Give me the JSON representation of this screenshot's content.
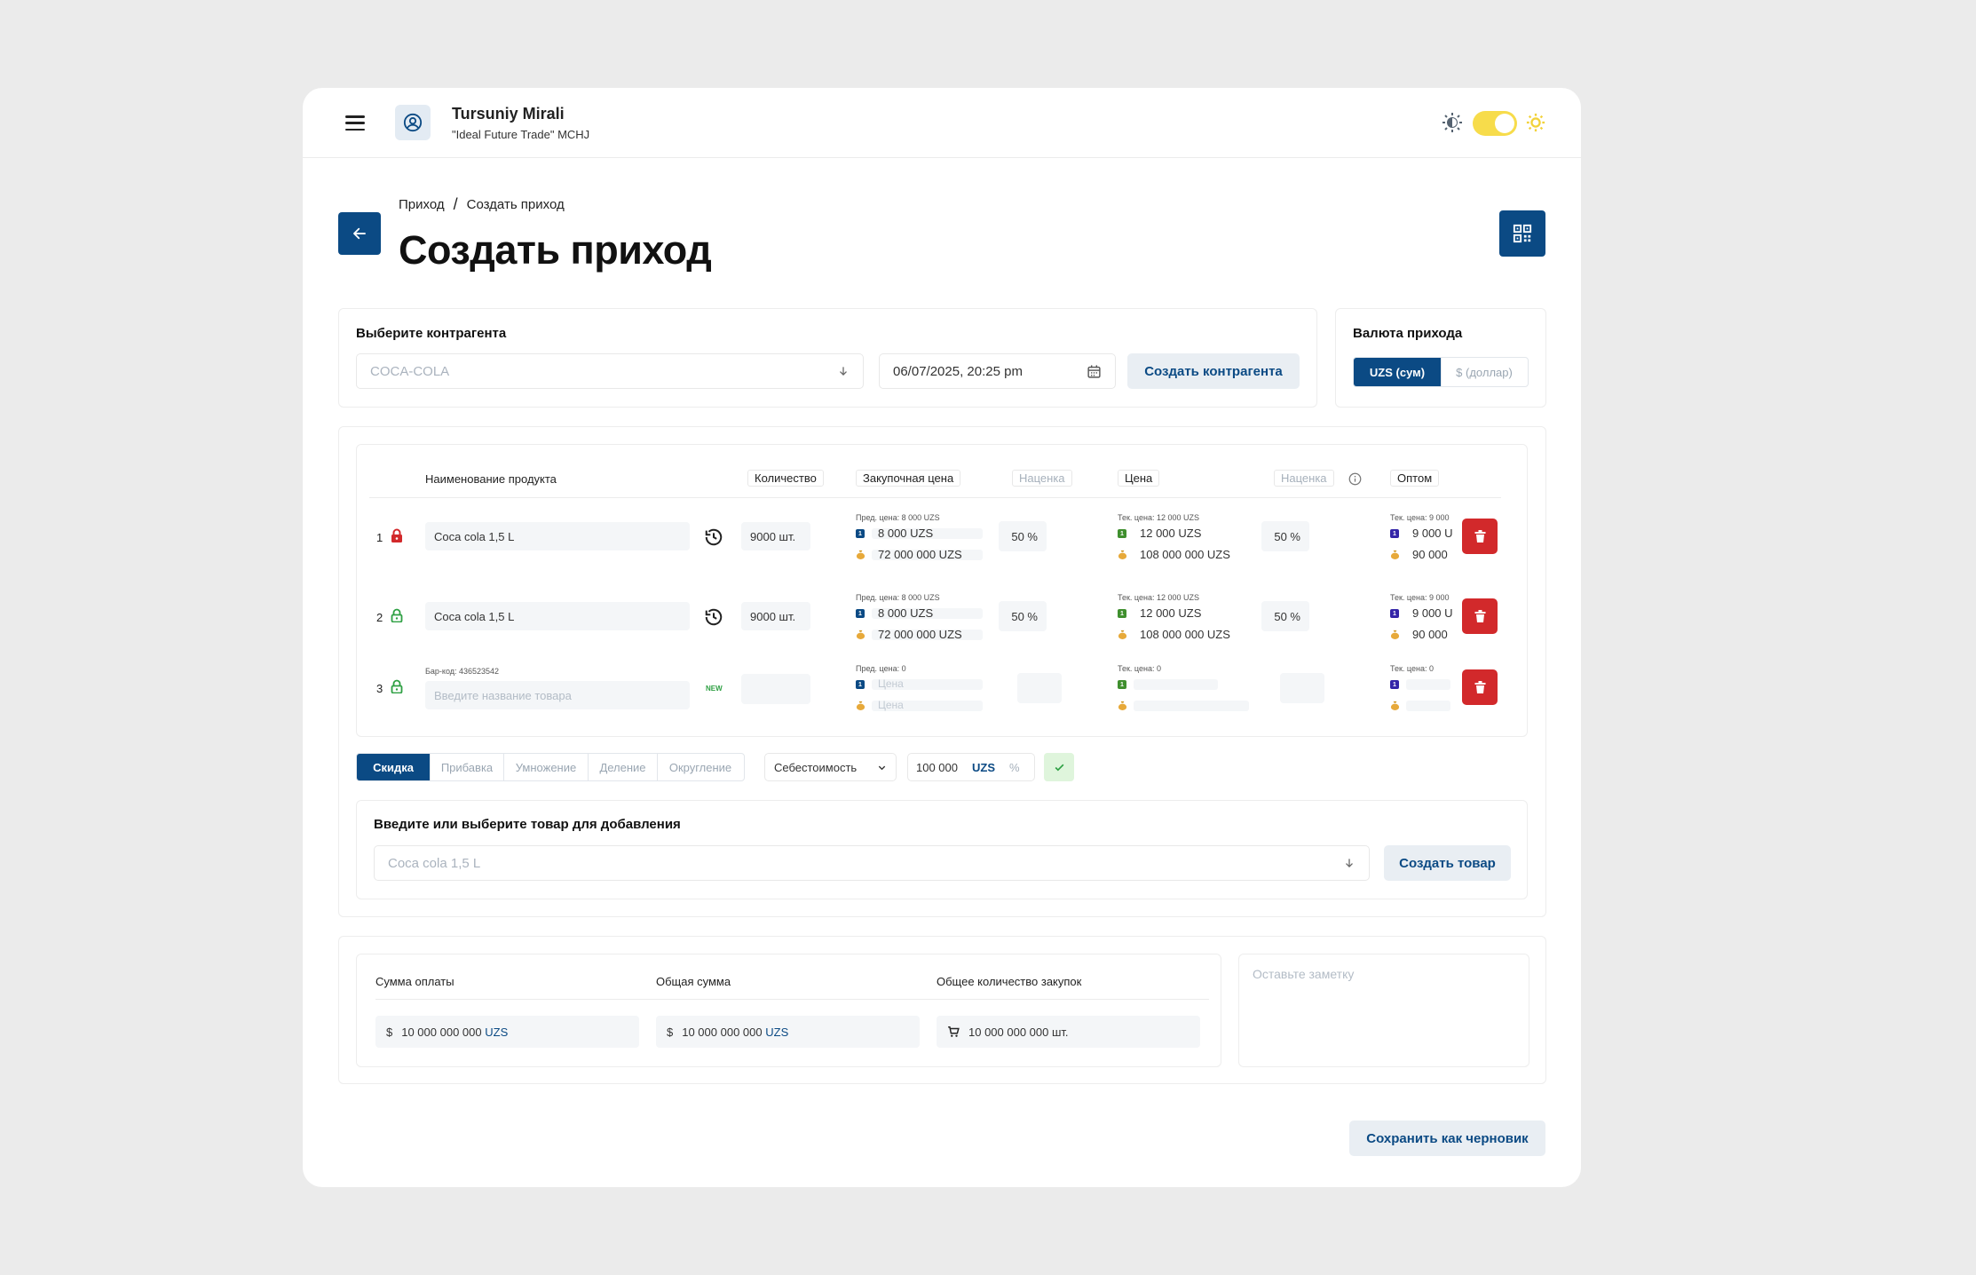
{
  "header": {
    "user_name": "Tursuniy Mirali",
    "user_org": "\"Ideal Future Trade\" MCHJ"
  },
  "breadcrumb": {
    "parent": "Приход",
    "sep": "/",
    "current": "Создать приход"
  },
  "page_title": "Создать приход",
  "counterparty": {
    "label": "Выберите контрагента",
    "placeholder": "COCA-COLA",
    "date": "06/07/2025, 20:25 pm",
    "create_button": "Создать контрагента"
  },
  "currency": {
    "label": "Валюта прихода",
    "options": [
      "UZS (сум)",
      "$ (доллар)"
    ],
    "selected": "UZS (сум)"
  },
  "table": {
    "headers": {
      "product": "Наименование продукта",
      "quantity": "Количество",
      "purchase_price": "Закупочная цена",
      "markup1": "Наценка",
      "price": "Цена",
      "markup2": "Наценка",
      "wholesale": "Оптом"
    },
    "rows": [
      {
        "num": "1",
        "locked": true,
        "product": "Coca cola 1,5 L",
        "quantity": "9000 шт.",
        "prev_price": "Пред. цена: 8 000 UZS",
        "purchase": "8 000 UZS",
        "purchase_total": "72 000 000 UZS",
        "markup1": "50 %",
        "cur_price": "Тек. цена: 12 000 UZS",
        "price": "12 000 UZS",
        "price_total": "108 000 000 UZS",
        "markup2": "50 %",
        "ws_cur": "Тек. цена: 9 000",
        "ws": "9 000 U",
        "ws_total": "90 000"
      },
      {
        "num": "2",
        "locked": false,
        "product": "Coca cola 1,5 L",
        "quantity": "9000 шт.",
        "prev_price": "Пред. цена: 8 000 UZS",
        "purchase": "8 000 UZS",
        "purchase_total": "72 000 000 UZS",
        "markup1": "50 %",
        "cur_price": "Тек. цена: 12 000 UZS",
        "price": "12 000 UZS",
        "price_total": "108 000 000 UZS",
        "markup2": "50 %",
        "ws_cur": "Тек. цена: 9 000",
        "ws": "9 000 U",
        "ws_total": "90 000"
      },
      {
        "num": "3",
        "locked": false,
        "barcode": "Бар-код: 436523542",
        "placeholder": "Введите название товара",
        "badge": "NEW",
        "prev_price": "Пред. цена: 0",
        "price_ph": "Цена",
        "price_ph2": "Цена",
        "cur_price": "Тек. цена: 0",
        "ws_cur": "Тек. цена: 0"
      }
    ]
  },
  "operations": {
    "tabs": [
      "Скидка",
      "Прибавка",
      "Умножение",
      "Деление",
      "Округление"
    ],
    "active": "Скидка",
    "base": "Себестоимость",
    "amount": "100 000",
    "unit_uzs": "UZS",
    "unit_pct": "%"
  },
  "add_product": {
    "label": "Введите или выберите товар для добавления",
    "placeholder": "Coca cola 1,5 L",
    "create_button": "Создать товар"
  },
  "summary": {
    "payment_label": "Сумма оплаты",
    "total_label": "Общая сумма",
    "count_label": "Общее количество закупок",
    "payment_value": "10 000 000 000",
    "total_value": "10 000 000 000",
    "count_value": "10 000 000 000 шт.",
    "currency": "UZS",
    "dollar_sign": "$"
  },
  "note_placeholder": "Оставьте заметку",
  "save_draft": "Сохранить как черновик",
  "colors": {
    "primary": "#0b4a84",
    "danger": "#d2292b",
    "toggle": "#f7dc4b",
    "green_lock": "#2ea043"
  }
}
